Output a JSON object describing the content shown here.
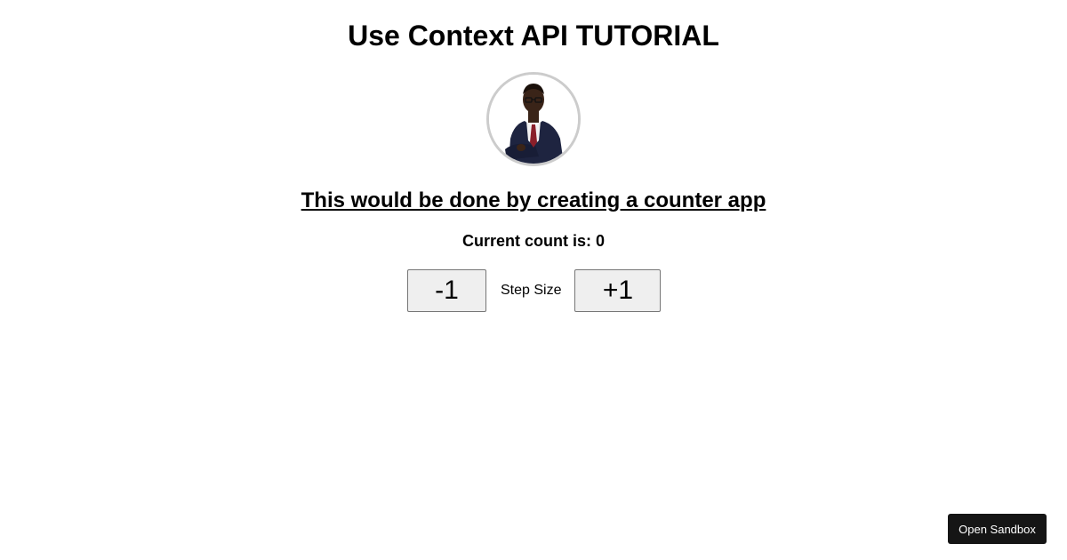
{
  "header": {
    "title": "Use Context API TUTORIAL"
  },
  "profile": {
    "avatar_icon": "person-photo"
  },
  "main": {
    "subtitle": "This would be done by creating a counter app",
    "count_text": "Current count is: 0",
    "current_count": 0
  },
  "controls": {
    "decrement_label": "-1",
    "step_label": "Step Size",
    "increment_label": "+1"
  },
  "footer": {
    "sandbox_label": "Open Sandbox"
  },
  "colors": {
    "background": "#ffffff",
    "text": "#000000",
    "button_bg": "#efefef",
    "button_border": "#767676",
    "sandbox_bg": "#151515",
    "avatar_border": "#cccccc"
  }
}
